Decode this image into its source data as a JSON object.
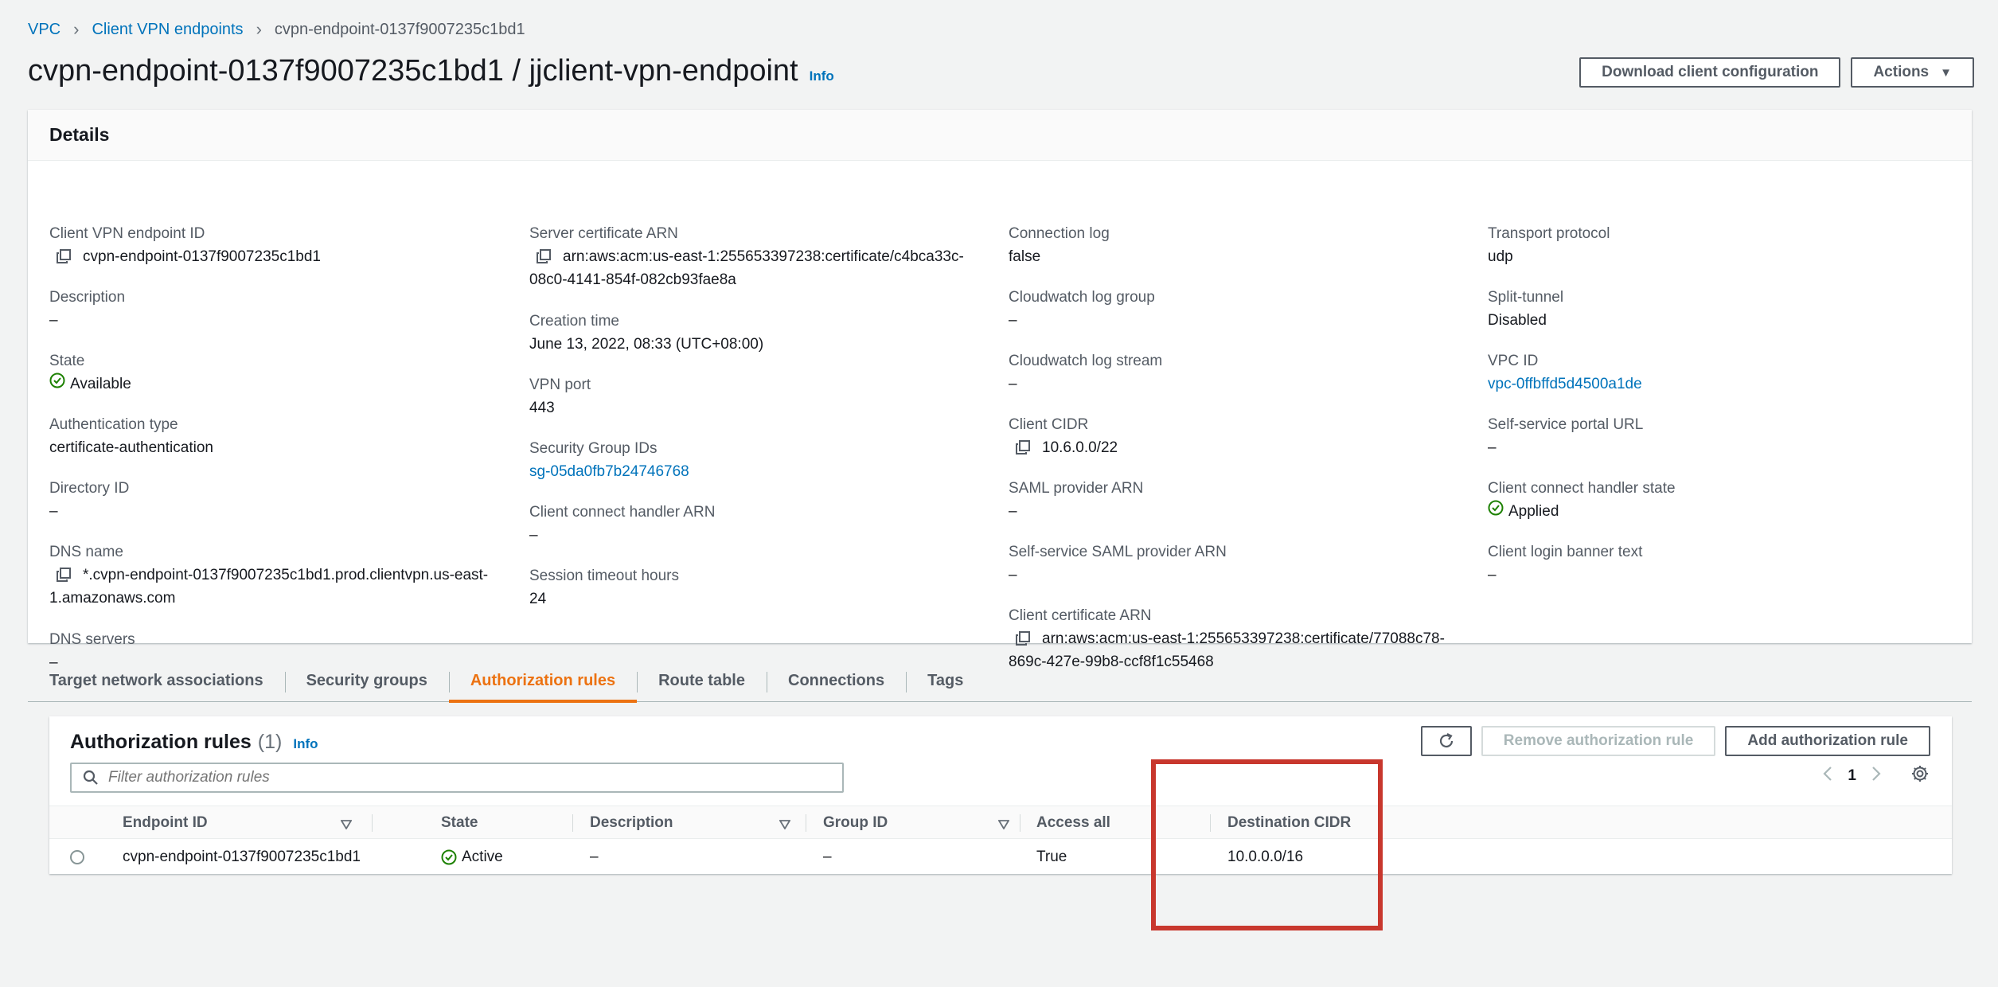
{
  "breadcrumb": {
    "items": [
      "VPC",
      "Client VPN endpoints"
    ],
    "current": "cvpn-endpoint-0137f9007235c1bd1"
  },
  "header": {
    "title": "cvpn-endpoint-0137f9007235c1bd1 / jjclient-vpn-endpoint",
    "info": "Info",
    "download_label": "Download client configuration",
    "actions_label": "Actions"
  },
  "details": {
    "heading": "Details",
    "col1": {
      "endpoint_id_label": "Client VPN endpoint ID",
      "endpoint_id": "cvpn-endpoint-0137f9007235c1bd1",
      "description_label": "Description",
      "description": "–",
      "state_label": "State",
      "state": "Available",
      "auth_type_label": "Authentication type",
      "auth_type": "certificate-authentication",
      "directory_id_label": "Directory ID",
      "directory_id": "–",
      "dns_name_label": "DNS name",
      "dns_name_line1": "*.cvpn-endpoint-0137f9007235c1bd1.prod.clientvpn.us-east-",
      "dns_name_line2": "1.amazonaws.com",
      "dns_servers_label": "DNS servers",
      "dns_servers": "–"
    },
    "col2": {
      "server_cert_label": "Server certificate ARN",
      "server_cert_line1": "arn:aws:acm:us-east-1:255653397238:certificate/c4bca33c-",
      "server_cert_line2": "08c0-4141-854f-082cb93fae8a",
      "creation_time_label": "Creation time",
      "creation_time": "June 13, 2022, 08:33 (UTC+08:00)",
      "vpn_port_label": "VPN port",
      "vpn_port": "443",
      "sg_ids_label": "Security Group IDs",
      "sg_ids": "sg-05da0fb7b24746768",
      "connect_handler_arn_label": "Client connect handler ARN",
      "connect_handler_arn": "–",
      "session_timeout_label": "Session timeout hours",
      "session_timeout": "24"
    },
    "col3": {
      "connection_log_label": "Connection log",
      "connection_log": "false",
      "cw_log_group_label": "Cloudwatch log group",
      "cw_log_group": "–",
      "cw_log_stream_label": "Cloudwatch log stream",
      "cw_log_stream": "–",
      "client_cidr_label": "Client CIDR",
      "client_cidr": "10.6.0.0/22",
      "saml_arn_label": "SAML provider ARN",
      "saml_arn": "–",
      "ss_saml_arn_label": "Self-service SAML provider ARN",
      "ss_saml_arn": "–",
      "client_cert_label": "Client certificate ARN",
      "client_cert_line1": "arn:aws:acm:us-east-1:255653397238:certificate/77088c78-",
      "client_cert_line2": "869c-427e-99b8-ccf8f1c55468"
    },
    "col4": {
      "transport_label": "Transport protocol",
      "transport": "udp",
      "split_tunnel_label": "Split-tunnel",
      "split_tunnel": "Disabled",
      "vpc_id_label": "VPC ID",
      "vpc_id": "vpc-0ffbffd5d4500a1de",
      "portal_url_label": "Self-service portal URL",
      "portal_url": "–",
      "handler_state_label": "Client connect handler state",
      "handler_state": "Applied",
      "banner_label": "Client login banner text",
      "banner": "–"
    }
  },
  "tabs": [
    {
      "label": "Target network associations",
      "active": false
    },
    {
      "label": "Security groups",
      "active": false
    },
    {
      "label": "Authorization rules",
      "active": true
    },
    {
      "label": "Route table",
      "active": false
    },
    {
      "label": "Connections",
      "active": false
    },
    {
      "label": "Tags",
      "active": false
    }
  ],
  "rules": {
    "title": "Authorization rules",
    "count": "(1)",
    "info": "Info",
    "remove_label": "Remove authorization rule",
    "add_label": "Add authorization rule",
    "filter_placeholder": "Filter authorization rules",
    "page": "1",
    "columns": [
      "Endpoint ID",
      "State",
      "Description",
      "Group ID",
      "Access all",
      "Destination CIDR"
    ],
    "row": {
      "endpoint_id": "cvpn-endpoint-0137f9007235c1bd1",
      "state": "Active",
      "description": "–",
      "group_id": "–",
      "access_all": "True",
      "destination_cidr": "10.0.0.0/16"
    }
  },
  "colors": {
    "link": "#0073bb",
    "success": "#1d8102",
    "tab_active": "#ec7211",
    "highlight": "#c8372d"
  }
}
